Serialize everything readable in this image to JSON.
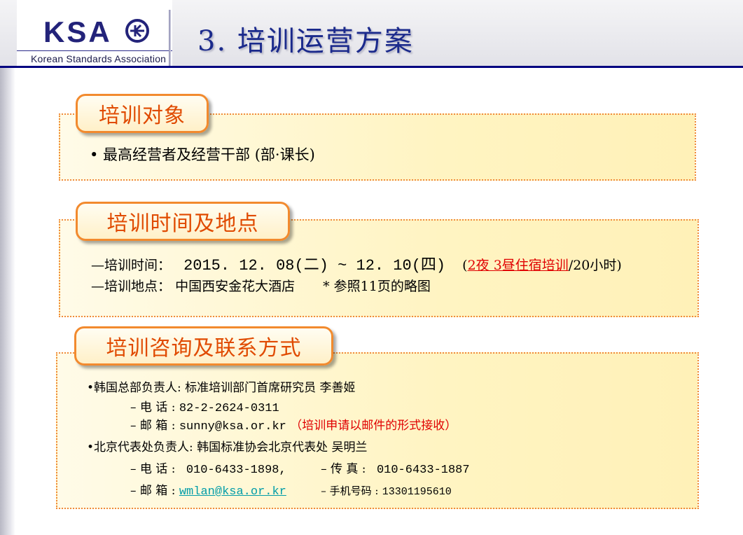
{
  "header": {
    "logo_text": "KSA",
    "logo_subtitle": "Korean Standards Association",
    "title": "3.  培训运营方案"
  },
  "section1": {
    "tag": "培训对象",
    "item": "• 最高经营者及经营干部 (部·课长)"
  },
  "section2": {
    "tag": "培训时间及地点",
    "time_label": "—培训时间：",
    "time_value": "2015. 12. 08(二) ~ 12. 10(四)",
    "time_note_open": "(",
    "time_note_red": "2夜 3昼住宿培训",
    "time_note_rest": "/20小时)",
    "place_label": "—培训地点：",
    "place_value": "中国西安金花大酒店",
    "place_note": "* 参照11页的略图"
  },
  "section3": {
    "tag": "培训咨询及联系方式",
    "korea_contact": "•韩国总部负责人: 标准培训部门首席研究员 李善姬",
    "korea_phone_label": "– 电   话 :",
    "korea_phone": "82-2-2624-0311",
    "korea_email_label": "– 邮   箱 :",
    "korea_email": "sunny@ksa.or.kr",
    "korea_email_note": "（培训申请以邮件的形式接收）",
    "beijing_contact": "•北京代表处负责人: 韩国标准协会北京代表处 吴明兰",
    "bj_phone_label": "– 电   话 :",
    "bj_phone": "010-6433-1898,",
    "bj_fax_label": "– 传    真   :",
    "bj_fax": "010-6433-1887",
    "bj_email_label": "– 邮   箱 :",
    "bj_email": "wmlan@ksa.or.kr",
    "bj_mobile_label": "– 手机号码 :",
    "bj_mobile": "13301195610"
  },
  "colors": {
    "title_blue": "#1b2a8c",
    "accent_orange": "#f28a2e",
    "tag_text": "#e04a00",
    "panel_fill": "#fff4c2",
    "note_red": "#e00000",
    "link_teal": "#009ca8"
  }
}
